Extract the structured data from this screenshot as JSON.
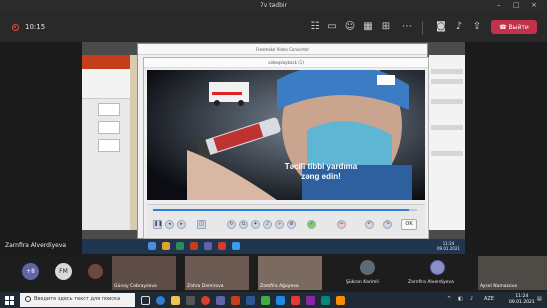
{
  "window": {
    "title": "7v tədbir"
  },
  "meeting": {
    "timer": "10:15",
    "leave_label": "Выйти"
  },
  "shared_screen": {
    "presenter_name": "Zarnfira Alverdiyeva",
    "converter_title": "Freemake Video Converter",
    "player_title": "videoplayback (1)",
    "video_caption": [
      "Təcili tibbi yardıma",
      "zəng edin!"
    ],
    "playback_progress": 0.97,
    "ok_label": "OK",
    "inner_clock_time": "11:24",
    "inner_clock_date": "09.01.2021"
  },
  "participants": {
    "chips": [
      {
        "label": "+8",
        "color": "#6264a7"
      },
      {
        "label": "FM",
        "color": "#d9d9d9"
      }
    ],
    "tiles": [
      {
        "name": "Günay Cəbrayılova"
      },
      {
        "name": "Zəhra Dəmirova"
      },
      {
        "name": "Zəmfira Ağayeva"
      },
      {
        "name": "Şükran Kərimli"
      },
      {
        "name": "Zərnfira Alverdiyeva"
      },
      {
        "name": "Aysel Namazova"
      }
    ]
  },
  "taskbar": {
    "search_placeholder": "Введите здесь текст для поиска",
    "language": "AZE",
    "time": "11:24",
    "date": "09.01.2021"
  }
}
